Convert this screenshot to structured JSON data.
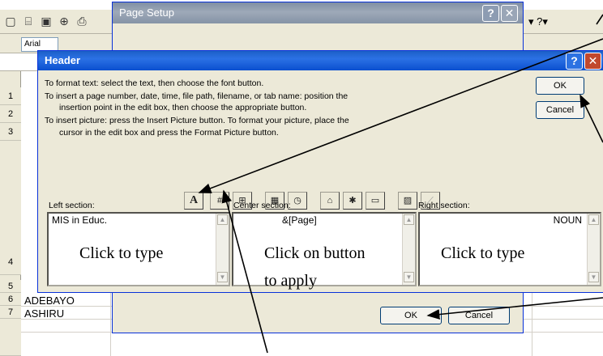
{
  "excel": {
    "font_box": "Arial",
    "rows": [
      {
        "num": "1",
        "text": ""
      },
      {
        "num": "2",
        "text": ""
      },
      {
        "num": "3",
        "text": ""
      },
      {
        "num": "4",
        "text": ""
      },
      {
        "num": "5",
        "text": ""
      },
      {
        "num": "6",
        "text": "ADEBAYO"
      },
      {
        "num": "7",
        "text": "ASHIRU"
      }
    ],
    "toolbar_right": "▾  ?▾"
  },
  "page_setup": {
    "title": "Page Setup",
    "ok_label": "OK",
    "cancel_label": "Cancel"
  },
  "header_dialog": {
    "title": "Header",
    "instructions": [
      "To format text:  select the text, then choose the font button.",
      "To insert a page number, date, time, file path, filename, or tab name:  position the",
      "insertion point in the edit box, then choose the appropriate button.",
      "To insert picture: press the Insert Picture button.  To format your picture, place the",
      "cursor in the edit box and press the Format Picture button."
    ],
    "ok_label": "OK",
    "cancel_label": "Cancel",
    "format_buttons": [
      {
        "icon": "font-icon",
        "glyph": "A"
      },
      {
        "icon": "page-number-icon",
        "glyph": "#"
      },
      {
        "icon": "total-pages-icon",
        "glyph": "⊞"
      },
      {
        "icon": "date-icon",
        "glyph": "▦"
      },
      {
        "icon": "time-icon",
        "glyph": "◷"
      },
      {
        "icon": "file-path-icon",
        "glyph": "⌂"
      },
      {
        "icon": "filename-icon",
        "glyph": "✱"
      },
      {
        "icon": "sheet-name-icon",
        "glyph": "▭"
      },
      {
        "icon": "insert-picture-icon",
        "glyph": "▨"
      },
      {
        "icon": "format-picture-icon",
        "glyph": "⟋"
      }
    ],
    "sections": {
      "left": {
        "label": "Left section:",
        "value": "MIS in Educ."
      },
      "center": {
        "label": "Center section:",
        "value": "&[Page]"
      },
      "right": {
        "label": "Right section:",
        "value": "NOUN"
      }
    }
  },
  "annotations": {
    "left_hint": "Click to type",
    "center_hint_line1": "Click on button",
    "center_hint_line2": "to apply",
    "right_hint": "Click to type"
  }
}
